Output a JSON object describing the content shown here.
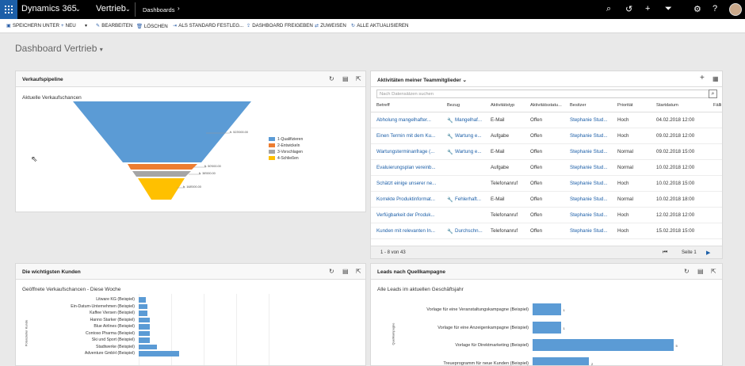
{
  "nav": {
    "app_title": "Dynamics 365",
    "area": "Vertrieb",
    "crumb": "Dashboards"
  },
  "commands": [
    "SPEICHERN UNTER",
    "NEU",
    "BEARBEITEN",
    "LÖSCHEN",
    "ALS STANDARD FESTLEG...",
    "DASHBOARD FREIGEBEN",
    "ZUWEISEN",
    "ALLE AKTUALISIEREN"
  ],
  "dashboard_title": "Dashboard Vertrieb",
  "pipeline": {
    "title": "Verkaufspipeline",
    "subtitle": "Aktuelle Verkaufschancen",
    "chart_data": {
      "type": "funnel",
      "stages": [
        {
          "name": "1-Qualifizieren",
          "value": 523000,
          "label": "fr. 523'000.00",
          "color": "#5b9bd5"
        },
        {
          "name": "2-Entwickeln",
          "value": 50000,
          "label": "fr. 50'000.00",
          "color": "#ed7d31"
        },
        {
          "name": "3-Vorschlagen",
          "value": 38000,
          "label": "fr. 38'000.00",
          "color": "#a5a5a5"
        },
        {
          "name": "4-Schließen",
          "value": 168000,
          "label": "fr. 168'000.00",
          "color": "#ffc000"
        }
      ],
      "legend": "right"
    }
  },
  "activities": {
    "title": "Aktivitäten meiner Teammitglieder",
    "search_placeholder": "Nach Datensätzen suchen",
    "columns": [
      "Betreff",
      "Bezug",
      "Aktivitätstyp",
      "Aktivitätsstatu...",
      "Besitzer",
      "Priorität",
      "Startdatum",
      "Fälli"
    ],
    "rows": [
      [
        "Abholung mangelhafter...",
        "Mangelhaf...",
        "E-Mail",
        "Offen",
        "Stephanie Stud...",
        "Hoch",
        "04.02.2018 12:00"
      ],
      [
        "Einen Termin mit dem Ku...",
        "Wartung e...",
        "Aufgabe",
        "Offen",
        "Stephanie Stud...",
        "Hoch",
        "09.02.2018 12:00"
      ],
      [
        "Wartungsterminanfrage (...",
        "Wartung e...",
        "E-Mail",
        "Offen",
        "Stephanie Stud...",
        "Normal",
        "09.02.2018 15:00"
      ],
      [
        "Evaluierungsplan vereinb...",
        "",
        "Aufgabe",
        "Offen",
        "Stephanie Stud...",
        "Normal",
        "10.02.2018 12:00"
      ],
      [
        "Schätzt einige unserer ne...",
        "",
        "Telefonanruf",
        "Offen",
        "Stephanie Stud...",
        "Hoch",
        "10.02.2018 15:00"
      ],
      [
        "Korrekte Produktinformat...",
        "Fehlerhaft...",
        "E-Mail",
        "Offen",
        "Stephanie Stud...",
        "Normal",
        "10.02.2018 18:00"
      ],
      [
        "Verfügbarkeit der Produk...",
        "",
        "Telefonanruf",
        "Offen",
        "Stephanie Stud...",
        "Hoch",
        "12.02.2018 12:00"
      ],
      [
        "Kunden mit relevanten In...",
        "Durchschn...",
        "Telefonanruf",
        "Offen",
        "Stephanie Stud...",
        "Hoch",
        "15.02.2018 15:00"
      ]
    ],
    "footer_count": "1 - 8  von 43",
    "footer_page": "Seite 1"
  },
  "customers": {
    "title": "Die wichtigsten Kunden",
    "subtitle": "Geöffnete Verkaufschancen - Diese Woche",
    "chart_data": {
      "type": "bar",
      "orientation": "horizontal",
      "ylabel": "Potenzieller Kunde",
      "categories": [
        "Litware KG (Beispiel)",
        "Ein-Datum-Unternehmen (Beispiel)",
        "Kaffee Viersen (Beispiel)",
        "Hanno Starker (Beispiel)",
        "Blue Airlines (Beispiel)",
        "Contoso Pharma (Beispiel)",
        "Ski und Sport (Beispiel)",
        "Stadtwerke (Beispiel)",
        "Adventure GmbH (Beispiel)"
      ],
      "values": [
        1.5,
        2,
        2,
        2.5,
        2.5,
        2.5,
        2.5,
        4,
        9
      ],
      "color": "#5b9bd5"
    }
  },
  "leads": {
    "title": "Leads nach Quellkampagne",
    "subtitle": "Alle Leads im aktuellen Geschäftsjahr",
    "chart_data": {
      "type": "bar",
      "orientation": "horizontal",
      "ylabel": "Quellkampagne",
      "categories": [
        "Vorlage für eine Veranstaltungskampagne (Beispiel)",
        "Vorlage für eine Anzeigenkampagne (Beispiel)",
        "Vorlage für Direktmarketing (Beispiel)",
        "Treueprogramm für neue Kunden (Beispiel)"
      ],
      "values": [
        1,
        1,
        5,
        2
      ],
      "labels": [
        "1",
        "1",
        "5",
        "2"
      ],
      "color": "#5b9bd5"
    }
  }
}
